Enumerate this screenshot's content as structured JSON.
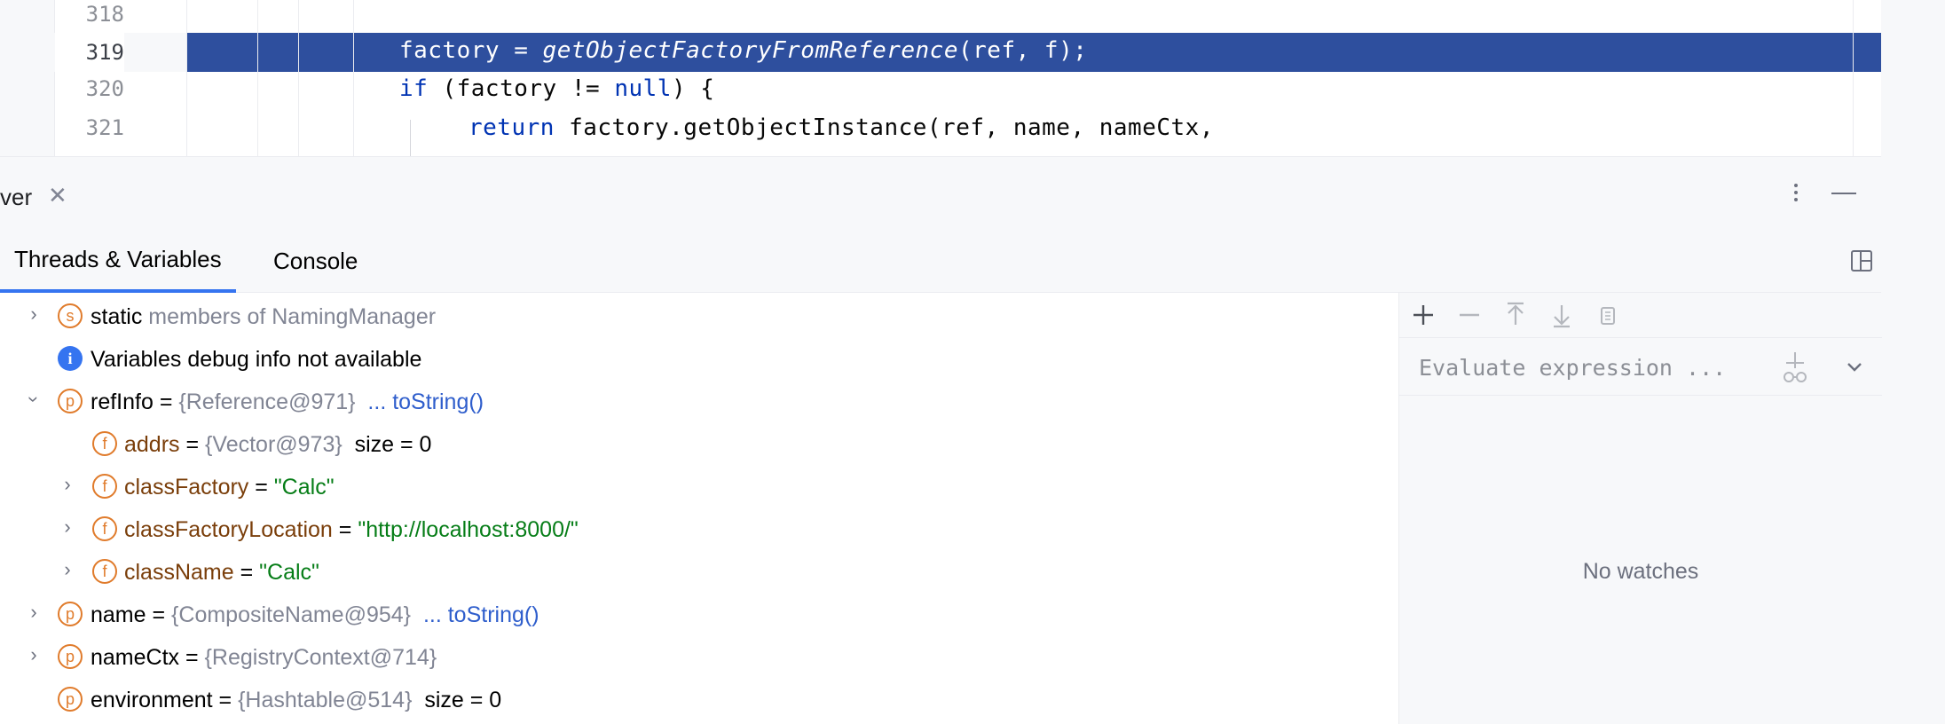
{
  "editor": {
    "lines": [
      {
        "num": "318"
      },
      {
        "num": "319"
      },
      {
        "num": "320"
      },
      {
        "num": "321"
      }
    ],
    "code": {
      "l319_a": "factory = ",
      "l319_b": "getObjectFactoryFromReference",
      "l319_c": "(ref, f);",
      "l320_kw": "if",
      "l320_a": " (factory != ",
      "l320_null": "null",
      "l320_b": ") {",
      "l321_kw": "return",
      "l321_a": " factory.getObjectInstance(ref, name, nameCtx,"
    },
    "colors": {
      "selection": "#2e4f9e",
      "keyword": "#0033b3"
    }
  },
  "tool_window": {
    "title": "ver",
    "close_icon": "close-icon",
    "more_icon": "more-vertical-icon",
    "minimize_icon": "minimize-icon"
  },
  "tabs": [
    {
      "label": "Threads & Variables",
      "active": true
    },
    {
      "label": "Console",
      "active": false
    }
  ],
  "variables": [
    {
      "badge": "s",
      "name": "static",
      "rest": " members of NamingManager"
    },
    {
      "badge": "i",
      "name": "Variables debug info not available"
    },
    {
      "badge": "p",
      "name": "refInfo",
      "eq": " = ",
      "value": "{Reference@971}",
      "link": "... toString()"
    },
    {
      "badge": "f",
      "name": "addrs",
      "eq": " = ",
      "value": "{Vector@973}",
      "extra": "  size = 0"
    },
    {
      "badge": "f",
      "name": "classFactory",
      "eq": " = ",
      "str": "\"Calc\""
    },
    {
      "badge": "f",
      "name": "classFactoryLocation",
      "eq": " = ",
      "str": "\"http://localhost:8000/\""
    },
    {
      "badge": "f",
      "name": "className",
      "eq": " = ",
      "str": "\"Calc\""
    },
    {
      "badge": "p",
      "name": "name",
      "eq": " = ",
      "value": "{CompositeName@954}",
      "link": "... toString()"
    },
    {
      "badge": "p",
      "name": "nameCtx",
      "eq": " = ",
      "value": "{RegistryContext@714}"
    },
    {
      "badge": "p",
      "name": "environment",
      "eq": " = ",
      "value": "{Hashtable@514}",
      "extra": "  size = 0"
    }
  ],
  "watches": {
    "toolbar_icons": [
      "add-icon",
      "remove-icon",
      "move-up-icon",
      "move-down-icon",
      "copy-icon"
    ],
    "eval_placeholder": "Evaluate expression ...",
    "empty_text": "No watches"
  }
}
